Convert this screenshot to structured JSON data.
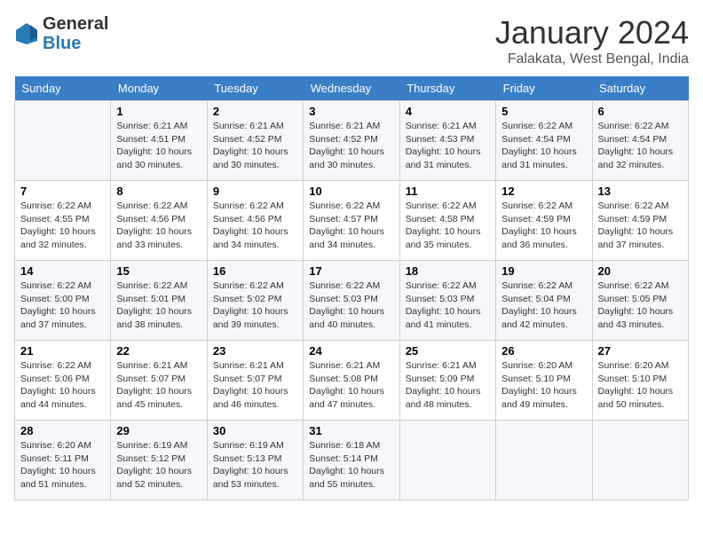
{
  "header": {
    "logo_general": "General",
    "logo_blue": "Blue",
    "month_title": "January 2024",
    "location": "Falakata, West Bengal, India"
  },
  "days_of_week": [
    "Sunday",
    "Monday",
    "Tuesday",
    "Wednesday",
    "Thursday",
    "Friday",
    "Saturday"
  ],
  "weeks": [
    [
      {
        "day": "",
        "text": ""
      },
      {
        "day": "1",
        "text": "Sunrise: 6:21 AM\nSunset: 4:51 PM\nDaylight: 10 hours\nand 30 minutes."
      },
      {
        "day": "2",
        "text": "Sunrise: 6:21 AM\nSunset: 4:52 PM\nDaylight: 10 hours\nand 30 minutes."
      },
      {
        "day": "3",
        "text": "Sunrise: 6:21 AM\nSunset: 4:52 PM\nDaylight: 10 hours\nand 30 minutes."
      },
      {
        "day": "4",
        "text": "Sunrise: 6:21 AM\nSunset: 4:53 PM\nDaylight: 10 hours\nand 31 minutes."
      },
      {
        "day": "5",
        "text": "Sunrise: 6:22 AM\nSunset: 4:54 PM\nDaylight: 10 hours\nand 31 minutes."
      },
      {
        "day": "6",
        "text": "Sunrise: 6:22 AM\nSunset: 4:54 PM\nDaylight: 10 hours\nand 32 minutes."
      }
    ],
    [
      {
        "day": "7",
        "text": "Sunrise: 6:22 AM\nSunset: 4:55 PM\nDaylight: 10 hours\nand 32 minutes."
      },
      {
        "day": "8",
        "text": "Sunrise: 6:22 AM\nSunset: 4:56 PM\nDaylight: 10 hours\nand 33 minutes."
      },
      {
        "day": "9",
        "text": "Sunrise: 6:22 AM\nSunset: 4:56 PM\nDaylight: 10 hours\nand 34 minutes."
      },
      {
        "day": "10",
        "text": "Sunrise: 6:22 AM\nSunset: 4:57 PM\nDaylight: 10 hours\nand 34 minutes."
      },
      {
        "day": "11",
        "text": "Sunrise: 6:22 AM\nSunset: 4:58 PM\nDaylight: 10 hours\nand 35 minutes."
      },
      {
        "day": "12",
        "text": "Sunrise: 6:22 AM\nSunset: 4:59 PM\nDaylight: 10 hours\nand 36 minutes."
      },
      {
        "day": "13",
        "text": "Sunrise: 6:22 AM\nSunset: 4:59 PM\nDaylight: 10 hours\nand 37 minutes."
      }
    ],
    [
      {
        "day": "14",
        "text": "Sunrise: 6:22 AM\nSunset: 5:00 PM\nDaylight: 10 hours\nand 37 minutes."
      },
      {
        "day": "15",
        "text": "Sunrise: 6:22 AM\nSunset: 5:01 PM\nDaylight: 10 hours\nand 38 minutes."
      },
      {
        "day": "16",
        "text": "Sunrise: 6:22 AM\nSunset: 5:02 PM\nDaylight: 10 hours\nand 39 minutes."
      },
      {
        "day": "17",
        "text": "Sunrise: 6:22 AM\nSunset: 5:03 PM\nDaylight: 10 hours\nand 40 minutes."
      },
      {
        "day": "18",
        "text": "Sunrise: 6:22 AM\nSunset: 5:03 PM\nDaylight: 10 hours\nand 41 minutes."
      },
      {
        "day": "19",
        "text": "Sunrise: 6:22 AM\nSunset: 5:04 PM\nDaylight: 10 hours\nand 42 minutes."
      },
      {
        "day": "20",
        "text": "Sunrise: 6:22 AM\nSunset: 5:05 PM\nDaylight: 10 hours\nand 43 minutes."
      }
    ],
    [
      {
        "day": "21",
        "text": "Sunrise: 6:22 AM\nSunset: 5:06 PM\nDaylight: 10 hours\nand 44 minutes."
      },
      {
        "day": "22",
        "text": "Sunrise: 6:21 AM\nSunset: 5:07 PM\nDaylight: 10 hours\nand 45 minutes."
      },
      {
        "day": "23",
        "text": "Sunrise: 6:21 AM\nSunset: 5:07 PM\nDaylight: 10 hours\nand 46 minutes."
      },
      {
        "day": "24",
        "text": "Sunrise: 6:21 AM\nSunset: 5:08 PM\nDaylight: 10 hours\nand 47 minutes."
      },
      {
        "day": "25",
        "text": "Sunrise: 6:21 AM\nSunset: 5:09 PM\nDaylight: 10 hours\nand 48 minutes."
      },
      {
        "day": "26",
        "text": "Sunrise: 6:20 AM\nSunset: 5:10 PM\nDaylight: 10 hours\nand 49 minutes."
      },
      {
        "day": "27",
        "text": "Sunrise: 6:20 AM\nSunset: 5:10 PM\nDaylight: 10 hours\nand 50 minutes."
      }
    ],
    [
      {
        "day": "28",
        "text": "Sunrise: 6:20 AM\nSunset: 5:11 PM\nDaylight: 10 hours\nand 51 minutes."
      },
      {
        "day": "29",
        "text": "Sunrise: 6:19 AM\nSunset: 5:12 PM\nDaylight: 10 hours\nand 52 minutes."
      },
      {
        "day": "30",
        "text": "Sunrise: 6:19 AM\nSunset: 5:13 PM\nDaylight: 10 hours\nand 53 minutes."
      },
      {
        "day": "31",
        "text": "Sunrise: 6:18 AM\nSunset: 5:14 PM\nDaylight: 10 hours\nand 55 minutes."
      },
      {
        "day": "",
        "text": ""
      },
      {
        "day": "",
        "text": ""
      },
      {
        "day": "",
        "text": ""
      }
    ]
  ]
}
